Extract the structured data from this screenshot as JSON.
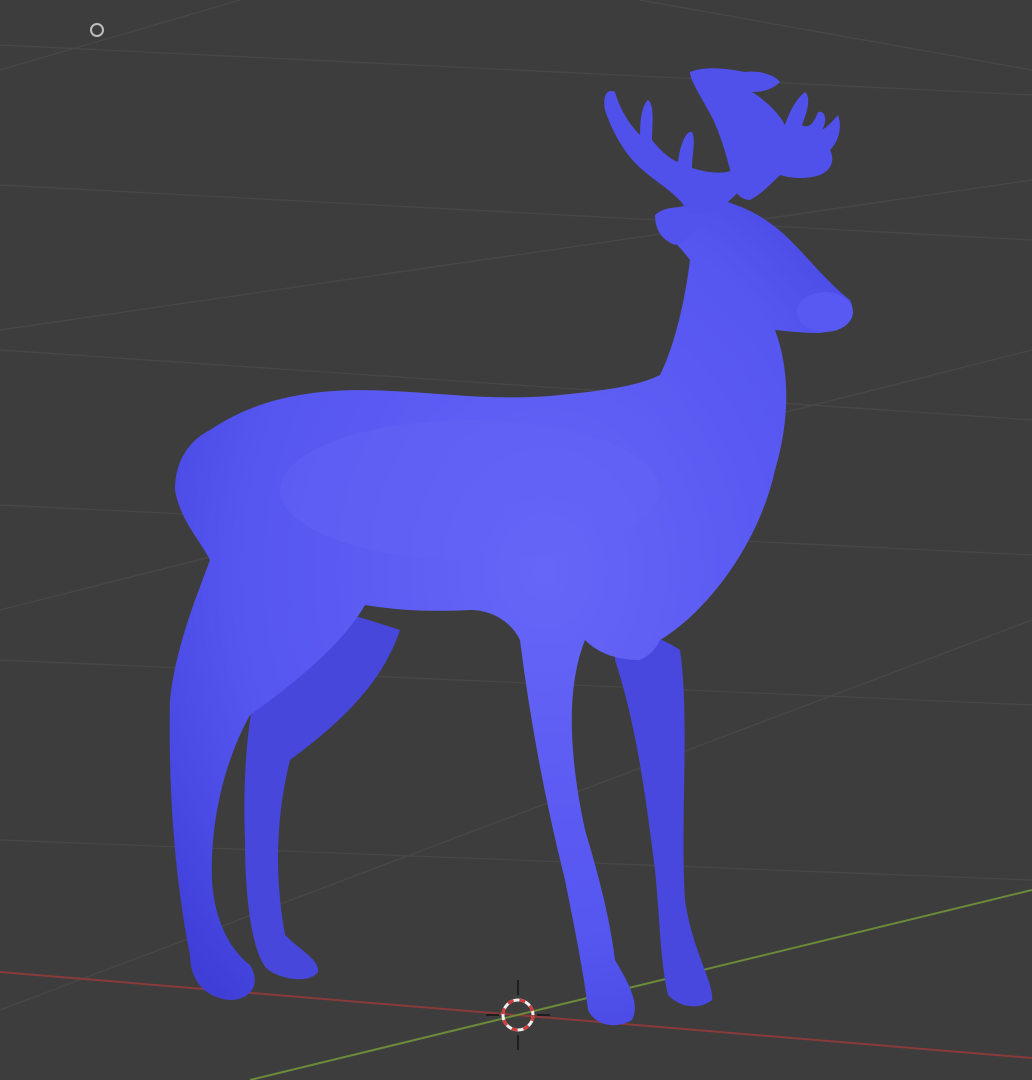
{
  "viewport": {
    "background": "#3d3d3d",
    "grid_color": "#474747",
    "axis_x_color": "#8a3a3a",
    "axis_y_color": "#6b8a3a"
  },
  "object": {
    "name_icon": "deer-mesh",
    "color": "#5555f0",
    "highlight": "#7a7aff",
    "shadow": "#3b3bd0"
  },
  "cursor": {
    "icon": "3d-cursor-icon",
    "ring_red": "#d23c3c",
    "ring_white": "#f0f0f0"
  },
  "light": {
    "icon": "light-object-icon"
  }
}
